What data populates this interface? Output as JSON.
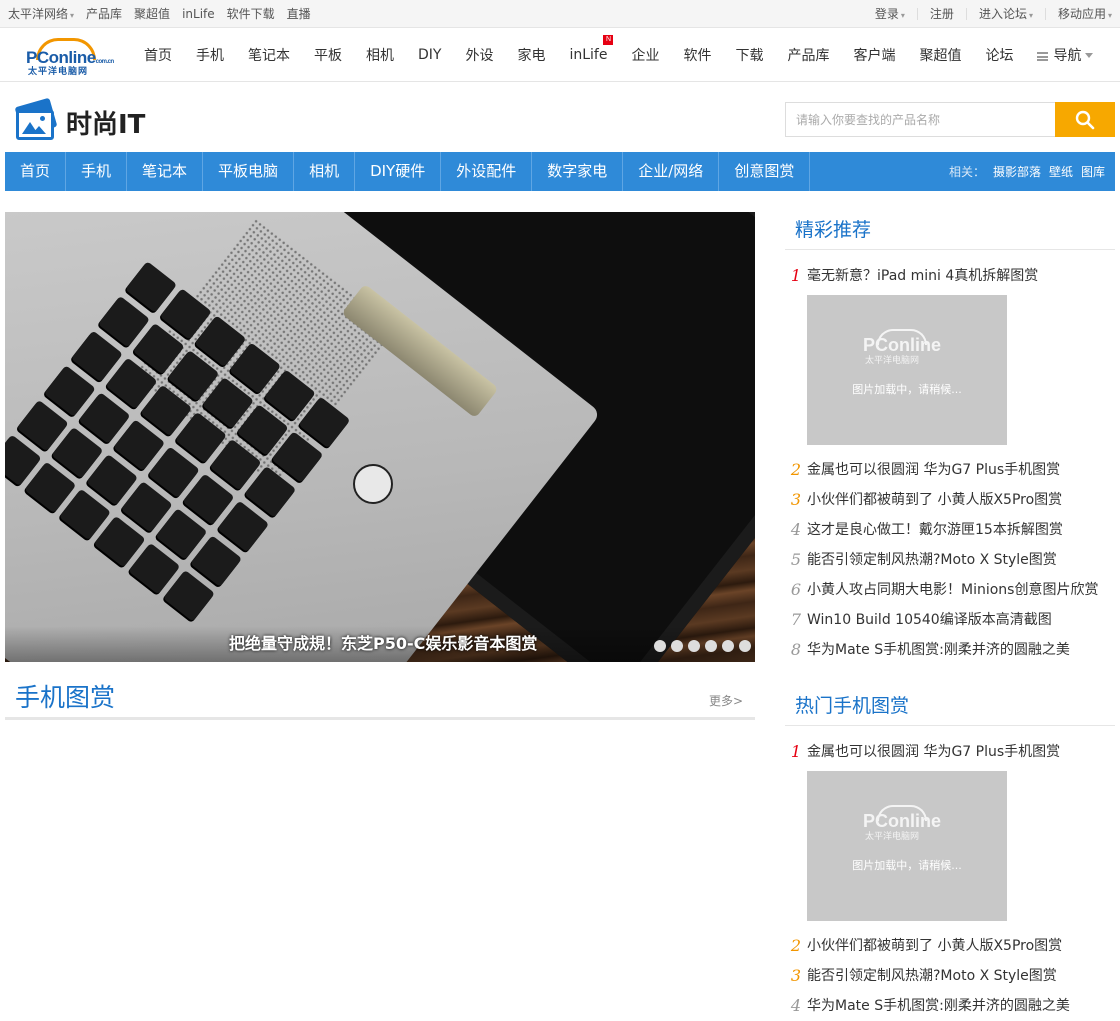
{
  "topbar": {
    "left": [
      "太平洋网络",
      "产品库",
      "聚超值",
      "inLife",
      "软件下载",
      "直播"
    ],
    "right": [
      "登录",
      "注册",
      "进入论坛",
      "移动应用"
    ]
  },
  "logo": {
    "word": "PConline",
    "suffix": "com.cn",
    "cn": "太平洋电脑网"
  },
  "sitenav": {
    "links": [
      "首页",
      "手机",
      "笔记本",
      "平板",
      "相机",
      "DIY",
      "外设",
      "家电",
      "inLife",
      "企业",
      "软件",
      "下载",
      "产品库",
      "客户端",
      "聚超值",
      "论坛"
    ],
    "badge": "N",
    "menu_label": "导航"
  },
  "channel": {
    "title": "时尚IT",
    "search_placeholder": "请输入你要查找的产品名称"
  },
  "channav": {
    "items": [
      "首页",
      "手机",
      "笔记本",
      "平板电脑",
      "相机",
      "DIY硬件",
      "外设配件",
      "数字家电",
      "企业/网络",
      "创意图赏"
    ],
    "related_label": "相关：",
    "related": [
      "摄影部落",
      "壁纸",
      "图库"
    ]
  },
  "hero": {
    "caption": "把绝量守成規！东芝P50-C娱乐影音本图赏",
    "dots": 6
  },
  "section": {
    "title": "手机图赏",
    "more": "更多>"
  },
  "featured": {
    "title": "精彩推荐",
    "items": [
      "毫无新意？iPad mini 4真机拆解图赏",
      "金属也可以很圆润 华为G7 Plus手机图赏",
      "小伙伴们都被萌到了 小黄人版X5Pro图赏",
      "这才是良心做工！戴尔游匣15本拆解图赏",
      "能否引领定制风热潮?Moto X Style图赏",
      "小黄人攻占同期大电影！Minions创意图片欣赏",
      "Win10 Build 10540编译版本高清截图",
      "华为Mate S手机图赏:刚柔并济的圆融之美"
    ],
    "placeholder": {
      "brand": "PConline",
      "cn": "太平洋电脑网",
      "loading": "图片加载中，请稍候..."
    }
  },
  "hotphones": {
    "title": "热门手机图赏",
    "items": [
      "金属也可以很圆润 华为G7 Plus手机图赏",
      "小伙伴们都被萌到了 小黄人版X5Pro图赏",
      "能否引领定制风热潮?Moto X Style图赏",
      "华为Mate S手机图赏:刚柔并济的圆融之美"
    ]
  }
}
